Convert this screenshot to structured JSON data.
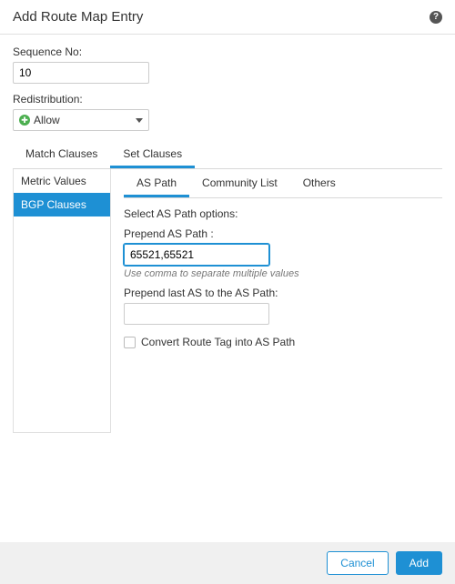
{
  "header": {
    "title": "Add Route Map Entry",
    "help_icon": "help-icon"
  },
  "sequence": {
    "label": "Sequence No:",
    "value": "10"
  },
  "redistribution": {
    "label": "Redistribution:",
    "value": "Allow",
    "icon": "allow-icon"
  },
  "tabs": {
    "match": "Match Clauses",
    "set": "Set Clauses"
  },
  "side": {
    "metric": "Metric Values",
    "bgp": "BGP Clauses"
  },
  "subtabs": {
    "aspath": "AS Path",
    "community": "Community List",
    "others": "Others"
  },
  "aspath_panel": {
    "heading": "Select AS Path options:",
    "prepend_label": "Prepend AS Path :",
    "prepend_value": "65521,65521",
    "prepend_hint": "Use comma to separate multiple values",
    "prepend_last_label": "Prepend last AS to the AS Path:",
    "prepend_last_value": "",
    "convert_label": "Convert Route Tag into AS Path"
  },
  "footer": {
    "cancel": "Cancel",
    "add": "Add"
  }
}
